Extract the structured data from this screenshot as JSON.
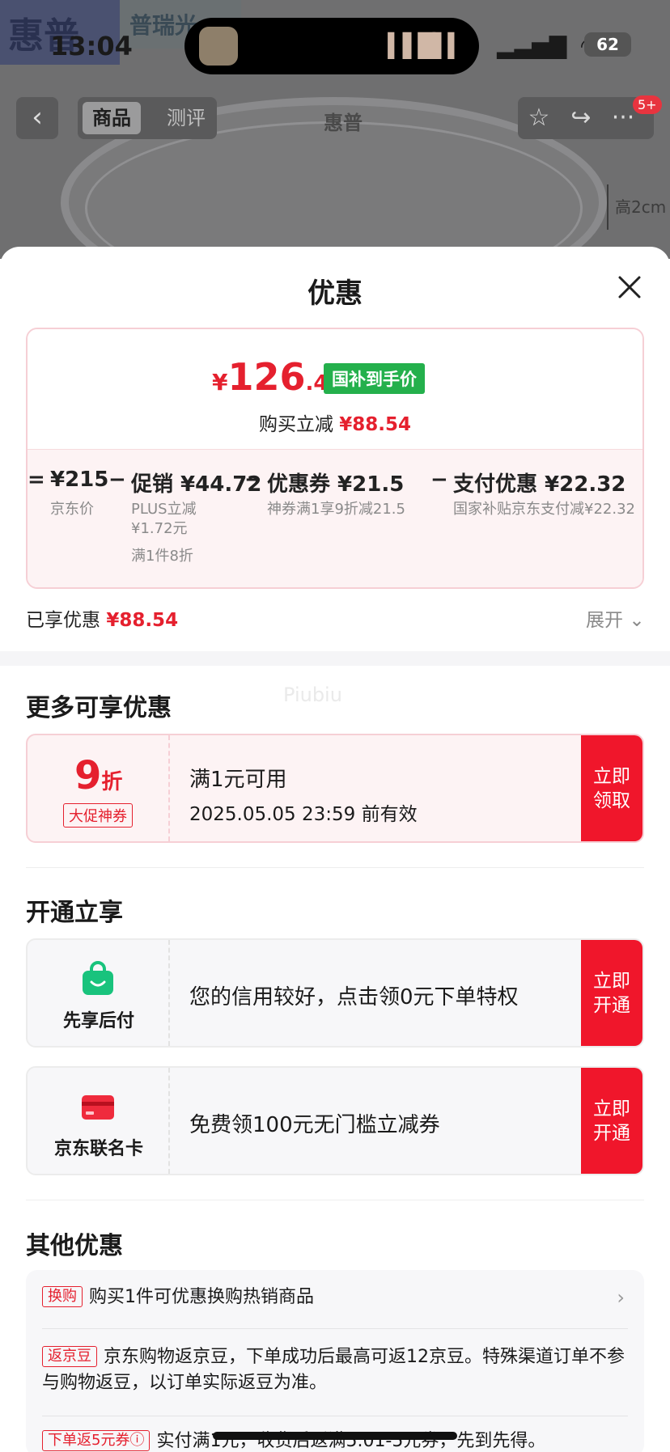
{
  "background": {
    "brand_logo": "惠普",
    "brand_secondary": "普瑞光",
    "size_label": "高2cm",
    "nav_tabs": [
      "商品",
      "测评"
    ],
    "nav_brand": "惠普",
    "badge": "5+"
  },
  "status_bar": {
    "time": "13:04",
    "signal": "....",
    "battery": "62"
  },
  "sheet": {
    "title": "优惠",
    "price": {
      "yen": "¥",
      "integer": "126",
      "decimal": ".46",
      "tag": "国补到手价",
      "buy_cut_label": "购买立减",
      "buy_cut_value": "¥88.54"
    },
    "breakdown": [
      {
        "op": "=",
        "value": "¥215",
        "sub": [
          "京东价"
        ]
      },
      {
        "op": "−",
        "value": "促销 ¥44.72",
        "sub": [
          "PLUS立减",
          "¥1.72元",
          "满1件8折"
        ]
      },
      {
        "op": "−",
        "value": "优惠券 ¥21.5",
        "sub": [
          "神券满1享9折减21.5"
        ]
      },
      {
        "op": "−",
        "value": "支付优惠 ¥22.32",
        "sub": [
          "国家补贴京东支付减¥22.32"
        ]
      }
    ],
    "summary_label": "已享优惠",
    "summary_value": "¥88.54",
    "expand_label": "展开"
  },
  "more_offers": {
    "title": "更多可享优惠",
    "watermark": "Piubiu",
    "coupon": {
      "amount": "9",
      "unit": "折",
      "tag": "大促神券",
      "condition": "满1元可用",
      "expiry": "2025.05.05 23:59 前有效",
      "button": "立即领取"
    }
  },
  "open_enjoy": {
    "title": "开通立享",
    "items": [
      {
        "label": "先享后付",
        "text": "您的信用较好，点击领0元下单特权",
        "button": "立即开通",
        "icon": "shopping-bag-icon"
      },
      {
        "label": "京东联名卡",
        "text": "免费领100元无门槛立减券",
        "button": "立即开通",
        "icon": "credit-card-icon"
      }
    ]
  },
  "other_offers": {
    "title": "其他优惠",
    "rows": [
      {
        "tag": "换购",
        "text": "购买1件可优惠换购热销商品"
      },
      {
        "tag": "返京豆",
        "text": "京东购物返京豆，下单成功后最高可返12京豆。特殊渠道订单不参与购物返豆，以订单实际返豆为准。"
      },
      {
        "tag": "下单返5元券ⓘ",
        "text": "实付满1元，收货后返满5.01-5元券，先到先得。"
      }
    ]
  },
  "colors": {
    "accent_red": "#e5202e",
    "button_red": "#f0162b",
    "green_tag": "#24b04c"
  }
}
